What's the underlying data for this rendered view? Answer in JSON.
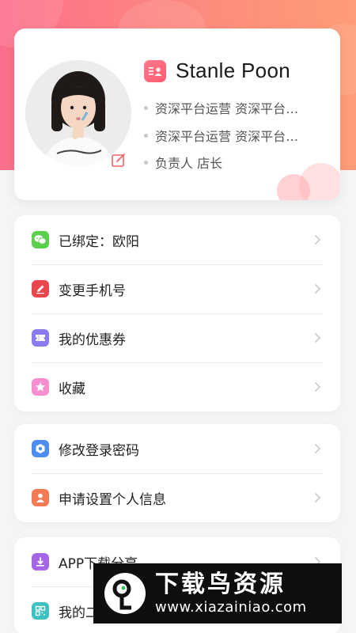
{
  "profile": {
    "name": "Stanle Poon",
    "lines": [
      "资深平台运营 资深平台运营",
      "资深平台运营 资深平台运营",
      "负责人 店长"
    ]
  },
  "menu_group_1": [
    {
      "label": "已绑定：欧阳",
      "icon": "wechat-icon",
      "color": "#5ccf4c"
    },
    {
      "label": "变更手机号",
      "icon": "edit-icon",
      "color": "#e9464b"
    },
    {
      "label": "我的优惠券",
      "icon": "coupon-icon",
      "color": "#8a7bf2"
    },
    {
      "label": "收藏",
      "icon": "star-icon",
      "color": "#f78fd0"
    }
  ],
  "menu_group_2": [
    {
      "label": "修改登录密码",
      "icon": "lock-icon",
      "color": "#4e8ef0"
    },
    {
      "label": "申请设置个人信息",
      "icon": "person-icon",
      "color": "#f47a55"
    }
  ],
  "menu_group_3": [
    {
      "label": "APP下载分享",
      "icon": "download-icon",
      "color": "#a466e6"
    },
    {
      "label": "我的二维码",
      "icon": "qrcode-icon",
      "color": "#3fc2bf"
    }
  ],
  "watermark": {
    "title": "下载鸟资源",
    "url": "www.xiazainiao.com"
  }
}
